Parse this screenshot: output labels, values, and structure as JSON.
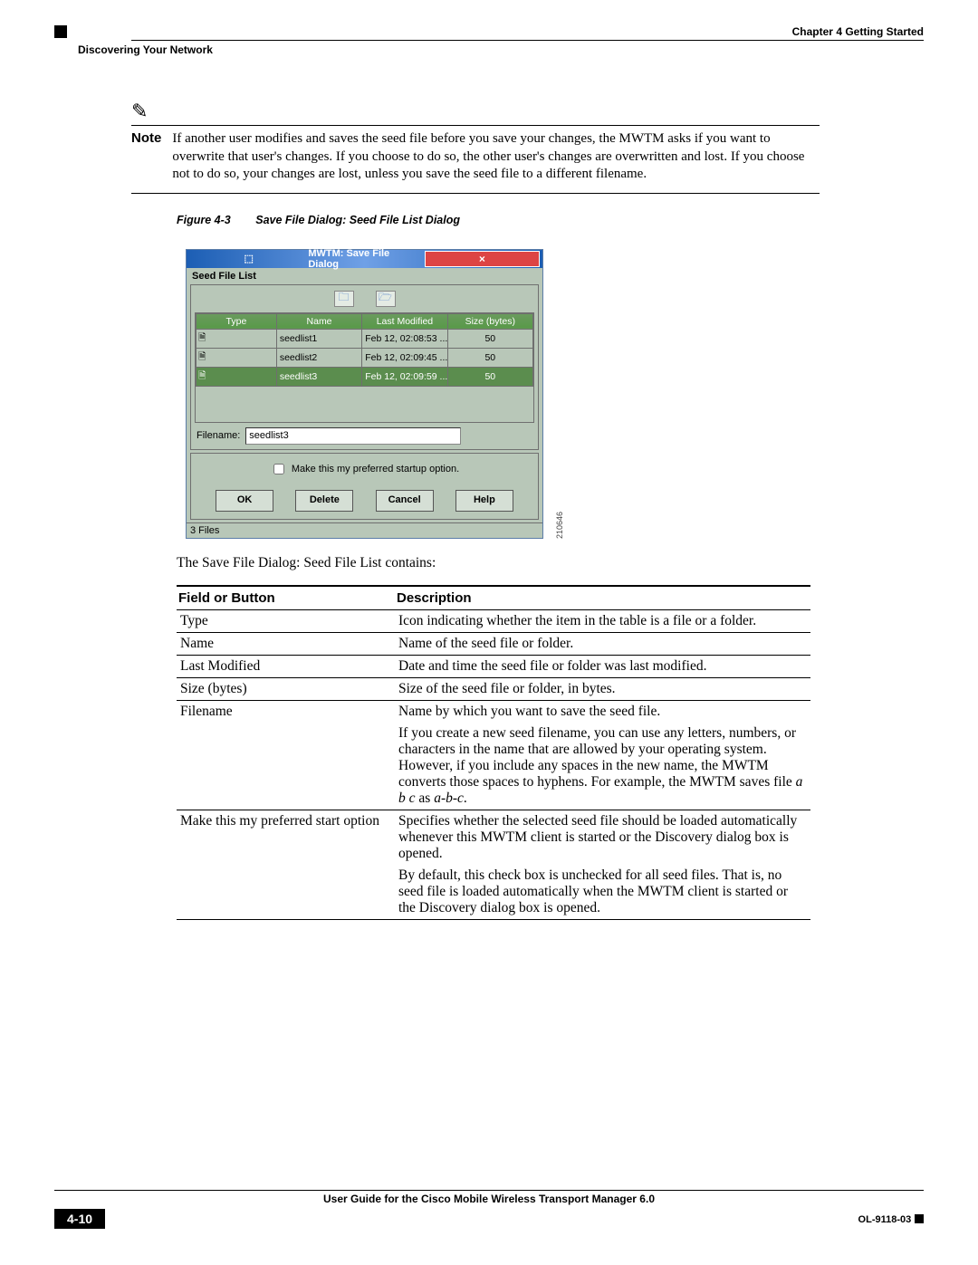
{
  "header": {
    "chapter": "Chapter 4      Getting Started",
    "section": "Discovering Your Network"
  },
  "note": {
    "label": "Note",
    "text": "If another user modifies and saves the seed file before you save your changes, the MWTM asks if you want to overwrite that user's changes. If you choose to do so, the other user's changes are overwritten and lost. If you choose not to do so, your changes are lost, unless you save the seed file to a different filename."
  },
  "figure": {
    "num": "Figure 4-3",
    "title": "Save File Dialog: Seed File List Dialog",
    "image_id": "210646"
  },
  "dialog": {
    "title": "MWTM: Save File Dialog",
    "subtitle": "Seed File List",
    "columns": {
      "type": "Type",
      "name": "Name",
      "lastmod": "Last Modified",
      "size": "Size (bytes)"
    },
    "rows": [
      {
        "name": "seedlist1",
        "lastmod": "Feb 12, 02:08:53 ...",
        "size": "50"
      },
      {
        "name": "seedlist2",
        "lastmod": "Feb 12, 02:09:45 ...",
        "size": "50"
      },
      {
        "name": "seedlist3",
        "lastmod": "Feb 12, 02:09:59 ...",
        "size": "50"
      }
    ],
    "filename_label": "Filename:",
    "filename_value": "seedlist3",
    "startup_label": "Make this my preferred startup option.",
    "buttons": {
      "ok": "OK",
      "del": "Delete",
      "cancel": "Cancel",
      "help": "Help"
    },
    "status": "3 Files"
  },
  "intro_sentence": "The Save File Dialog: Seed File List contains:",
  "table": {
    "headers": {
      "field": "Field or Button",
      "desc": "Description"
    },
    "rows": [
      {
        "field": "Type",
        "desc": "Icon indicating whether the item in the table is a file or a folder."
      },
      {
        "field": "Name",
        "desc": "Name of the seed file or folder."
      },
      {
        "field": "Last Modified",
        "desc": "Date and time the seed file or folder was last modified."
      },
      {
        "field": "Size (bytes)",
        "desc": "Size of the seed file or folder, in bytes."
      }
    ],
    "filename_field": "Filename",
    "filename_desc1": "Name by which you want to save the seed file.",
    "filename_desc2_pre": "If you create a new seed filename, you can use any letters, numbers, or characters in the name that are allowed by your operating system. However, if you include any spaces in the new name, the MWTM converts those spaces to hyphens. For example, the MWTM saves file ",
    "filename_desc2_em1": "a b c",
    "filename_desc2_mid": " as ",
    "filename_desc2_em2": "a-b-c",
    "filename_desc2_end": ".",
    "pref_field": "Make this my preferred start option",
    "pref_desc1": "Specifies whether the selected seed file should be loaded automatically whenever this MWTM client is started or the Discovery dialog box is opened.",
    "pref_desc2": "By default, this check box is unchecked for all seed files. That is, no seed file is loaded automatically when the MWTM client is started or the Discovery dialog box is opened."
  },
  "footer": {
    "title": "User Guide for the Cisco Mobile Wireless Transport Manager 6.0",
    "page": "4-10",
    "docnum": "OL-9118-03"
  }
}
